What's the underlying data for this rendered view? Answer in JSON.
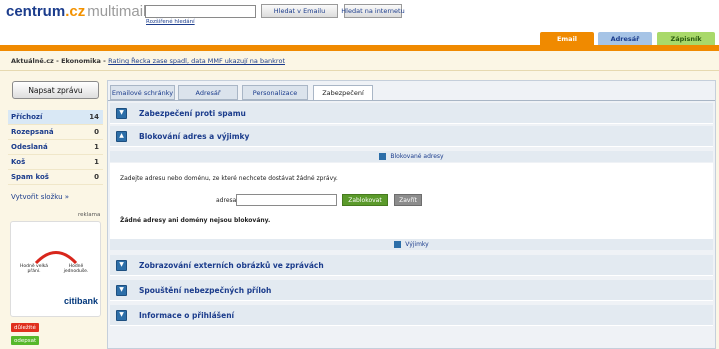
{
  "logo": {
    "part1": "centrum",
    "part2": ".cz",
    "part3": "multimail"
  },
  "search": {
    "placeholder": "",
    "btn_email": "Hledat v Emailu",
    "btn_internet": "Hledat na internetu",
    "advanced": "Rozšířené hledání"
  },
  "top_tabs": [
    {
      "label": "Email",
      "bg": "#f08a00",
      "fg": "#ffffff"
    },
    {
      "label": "Adresář",
      "bg": "#a6c4e6",
      "fg": "#1b3c8c"
    },
    {
      "label": "Zápisník",
      "bg": "#a9d96a",
      "fg": "#2a5a10"
    }
  ],
  "news": {
    "prefix": "Aktuálně.cz - Ekonomika - ",
    "link": "Rating Řecka zase spadl, data MMF ukazují na bankrot"
  },
  "compose_label": "Napsat zprávu",
  "folders": [
    {
      "name": "Příchozí",
      "count": "14"
    },
    {
      "name": "Rozepsaná",
      "count": "0"
    },
    {
      "name": "Odeslaná",
      "count": "1"
    },
    {
      "name": "Koš",
      "count": "1"
    },
    {
      "name": "Spam koš",
      "count": "0"
    }
  ],
  "create_folder": "Vytvořit složku »",
  "ad": {
    "label": "reklama",
    "left_text": "Hodně velká přání.",
    "right_text": "Hodně jednoduše.",
    "brand": "citibank"
  },
  "tags": [
    {
      "label": "důležité",
      "color": "#e0301e"
    },
    {
      "label": "odepsat",
      "color": "#56b82b"
    }
  ],
  "settings_tabs": [
    "Emailové schránky",
    "Adresář",
    "Personalizace",
    "Zabezpečení"
  ],
  "sections": {
    "spam": "Zabezpečení proti spamu",
    "block": "Blokování adres a výjimky",
    "blocked_sub": "Blokované adresy",
    "instructions": "Zadejte adresu nebo doménu, ze které nechcete dostávat žádné zprávy.",
    "address_label": "adresa",
    "required_mark": "*",
    "block_btn": "Zablokovat",
    "close_btn": "Zavřít",
    "no_addresses": "Žádné adresy ani domény nejsou blokovány.",
    "exceptions_sub": "Výjimky",
    "images": "Zobrazování externích obrázků ve zprávách",
    "attachments": "Spouštění nebezpečných příloh",
    "login_info": "Informace o přihlášení"
  },
  "colors": {
    "accent": "#f08a00",
    "brand_blue": "#1b3c8c",
    "block_green": "#5b9a2b"
  }
}
